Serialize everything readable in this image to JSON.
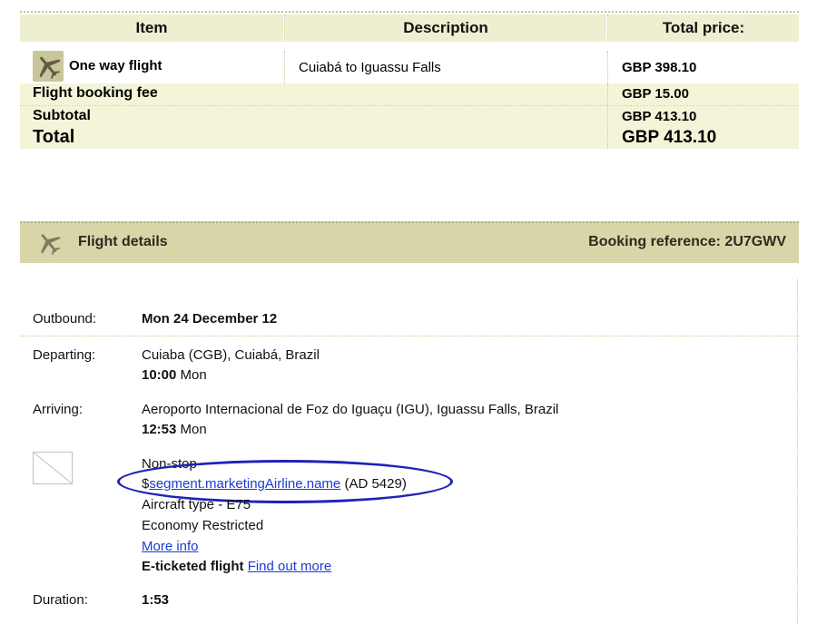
{
  "table": {
    "headers": {
      "item": "Item",
      "description": "Description",
      "total": "Total price:"
    },
    "rows": {
      "flight": {
        "item": "One way flight",
        "description": "Cuiabá to Iguassu Falls",
        "price": "GBP 398.10"
      },
      "fee": {
        "item": "Flight booking fee",
        "price": "GBP 15.00"
      },
      "subtotal": {
        "item": "Subtotal",
        "price": "GBP 413.10"
      },
      "total": {
        "item": "Total",
        "price": "GBP 413.10"
      }
    }
  },
  "flight_details": {
    "title": "Flight details",
    "booking_reference": "Booking reference: 2U7GWV",
    "outbound": {
      "label": "Outbound:",
      "value": "Mon 24 December 12"
    },
    "departing": {
      "label": "Departing:",
      "place": "Cuiaba (CGB), Cuiabá, Brazil",
      "time": "10:00",
      "day": "Mon"
    },
    "arriving": {
      "label": "Arriving:",
      "place": "Aeroporto Internacional de Foz do Iguaçu (IGU), Iguassu Falls, Brazil",
      "time": "12:53",
      "day": "Mon"
    },
    "segment": {
      "stops": "Non-stop",
      "dollar": "$",
      "airline_link": "segment.marketingAirline.name",
      "flight_number": "(AD 5429)",
      "aircraft": "Aircraft type - E75",
      "cabin": "Economy Restricted",
      "more_info": "More info",
      "eticket_label": "E-ticketed flight",
      "find_out_more": "Find out more"
    },
    "duration": {
      "label": "Duration:",
      "value": "1:53"
    }
  },
  "colors": {
    "header_band": "#eeeed0",
    "row_band": "#f4f4d9",
    "panel_header": "#d8d5a9",
    "link": "#1a3bd6",
    "highlight": "#1f22b8"
  },
  "icons": [
    "airplane-icon",
    "broken-image-icon"
  ]
}
